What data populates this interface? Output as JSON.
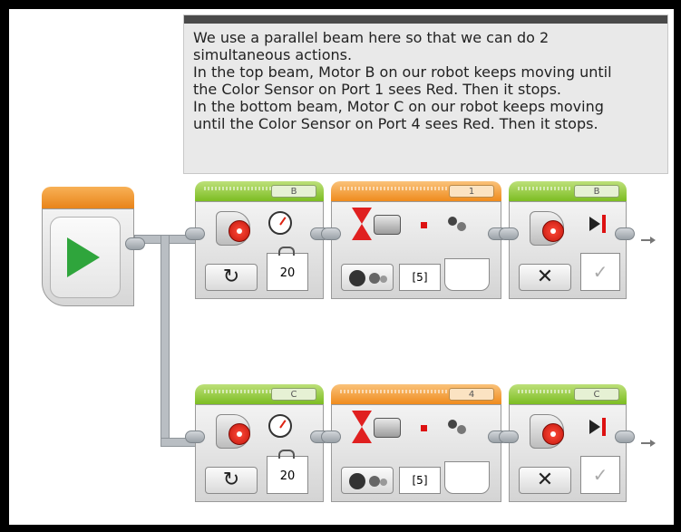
{
  "comment": {
    "lines": [
      "We use a parallel beam here so that we can do 2",
      "simultaneous actions.",
      "In the top beam, Motor B on our robot keeps moving until",
      "the Color Sensor on Port 1 sees Red.  Then it stops.",
      "In the bottom beam, Motor C on our robot keeps moving",
      "until the Color Sensor on Port 4 sees Red. Then it stops."
    ]
  },
  "top_beam": {
    "motor_on": {
      "port": "B",
      "power": "20",
      "mode_icon": "rotate-icon"
    },
    "wait": {
      "port": "1",
      "set": "[5]"
    },
    "motor_stop": {
      "port": "B",
      "mode_icon": "close-icon",
      "brake": "✓"
    }
  },
  "bottom_beam": {
    "motor_on": {
      "port": "C",
      "power": "20",
      "mode_icon": "rotate-icon"
    },
    "wait": {
      "port": "4",
      "set": "[5]"
    },
    "motor_stop": {
      "port": "C",
      "mode_icon": "close-icon",
      "brake": "✓"
    }
  },
  "colors": {
    "start_header": "#ef8b1d",
    "action_header": "#7cbd22",
    "flow_header": "#ef8b1d",
    "play": "#2fa53c",
    "motor_hub": "#d11"
  }
}
